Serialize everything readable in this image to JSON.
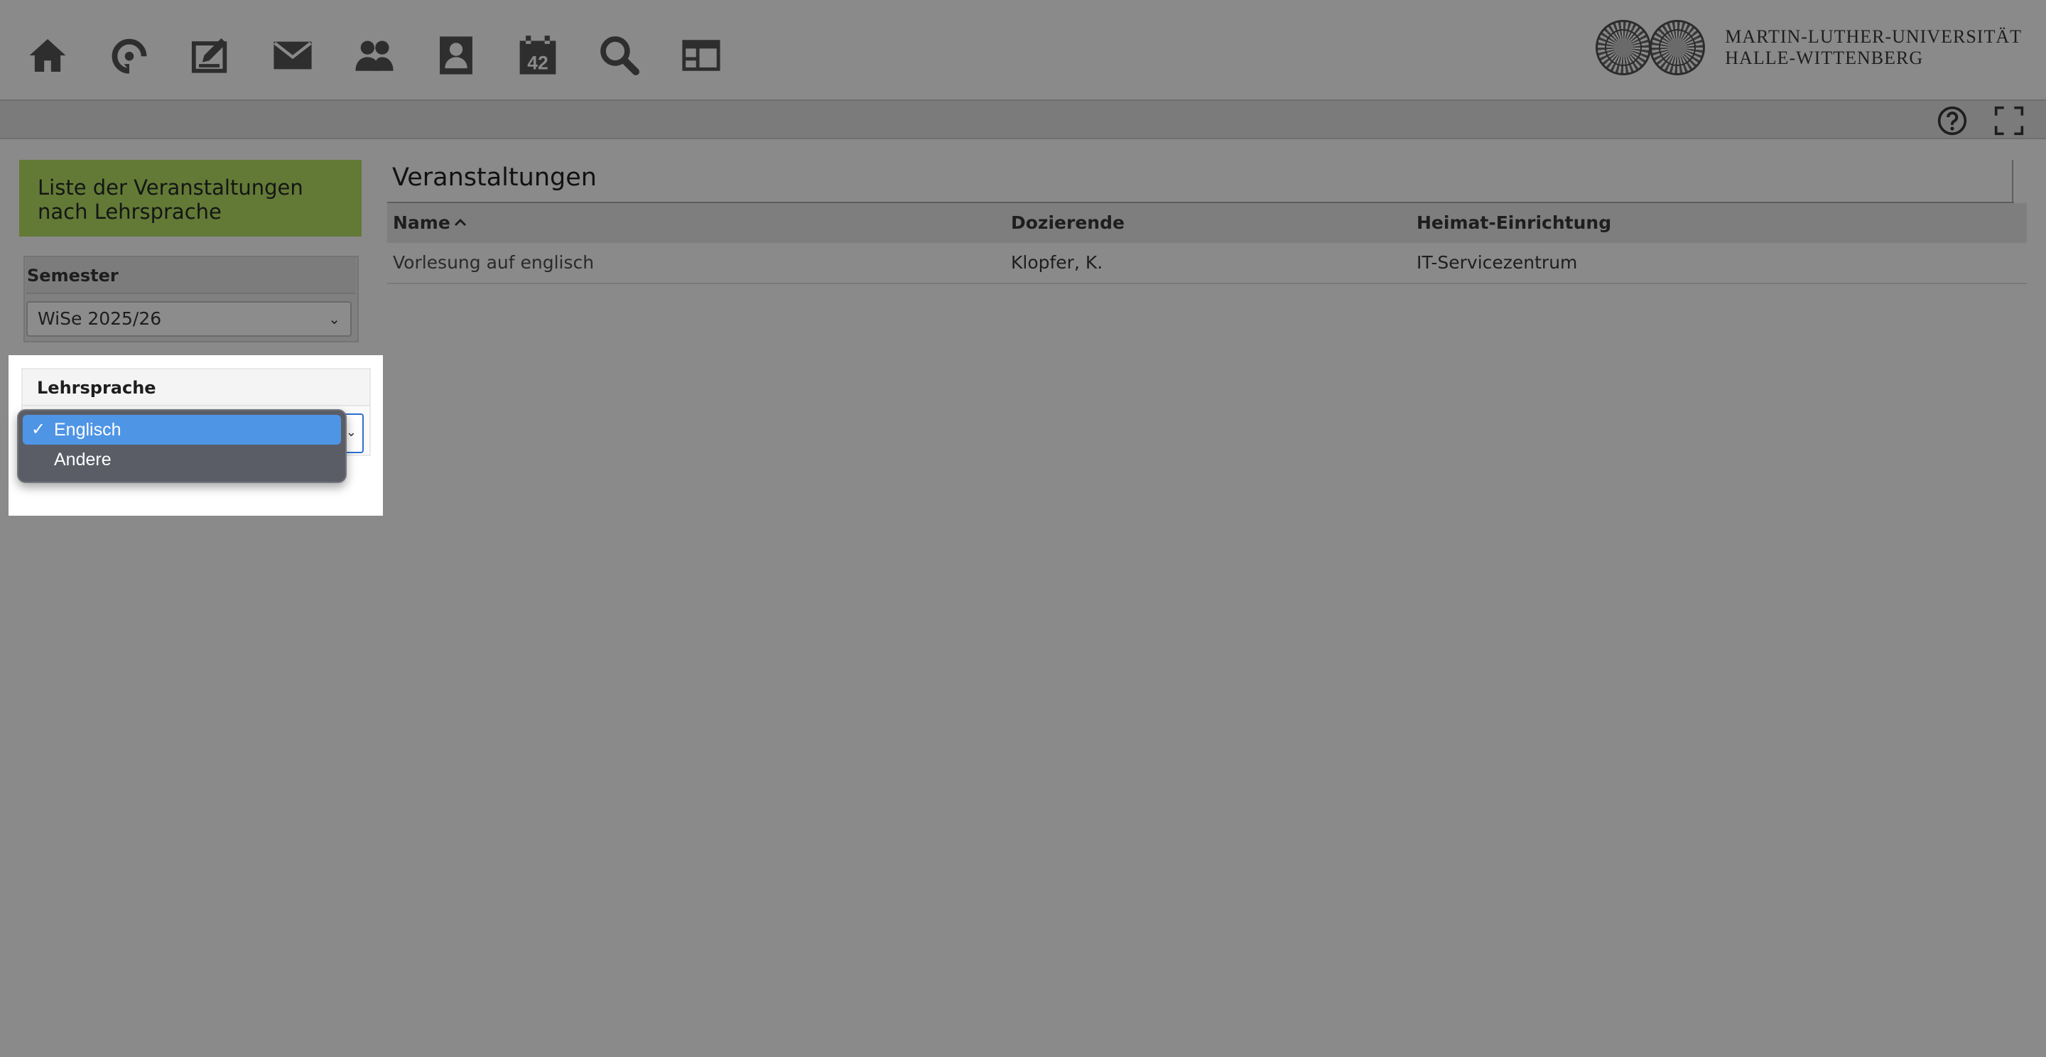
{
  "nav": {
    "items": [
      {
        "icon": "home-icon",
        "label": "Startseite"
      },
      {
        "icon": "target-icon",
        "label": "Aktivitäten"
      },
      {
        "icon": "edit-icon",
        "label": "Verwaltung"
      },
      {
        "icon": "mail-icon",
        "label": "Nachrichten"
      },
      {
        "icon": "people-icon",
        "label": "Kontakte"
      },
      {
        "icon": "profile-icon",
        "label": "Profil"
      },
      {
        "icon": "calendar-icon",
        "label": "Kalender",
        "badge": "42"
      },
      {
        "icon": "search-icon",
        "label": "Suche"
      },
      {
        "icon": "window-icon",
        "label": "Arbeitsbereich"
      }
    ]
  },
  "brand": {
    "line1": "MARTIN-LUTHER-UNIVERSITÄT",
    "line2": "HALLE-WITTENBERG"
  },
  "toolbar": {
    "help_icon": "help-icon",
    "fullscreen_icon": "fullscreen-icon"
  },
  "sidebar": {
    "title": "Liste der Veranstaltungen nach Lehrsprache",
    "semester": {
      "label": "Semester",
      "value": "WiSe 2025/26"
    },
    "language": {
      "label": "Lehrsprache",
      "options": [
        {
          "label": "Englisch",
          "selected": true
        },
        {
          "label": "Andere",
          "selected": false
        }
      ],
      "check": "✓"
    }
  },
  "main": {
    "title": "Veranstaltungen",
    "columns": [
      "Name",
      "Dozierende",
      "Heimat-Einrichtung"
    ],
    "rows": [
      {
        "name": "Vorlesung auf englisch",
        "lecturer": "Klopfer, K.",
        "institution": "IT-Servicezentrum"
      }
    ]
  },
  "colors": {
    "background": "#8a8a8a",
    "sidebar_title_bg": "#627a36",
    "dropdown_selected": "#4f95e5"
  }
}
